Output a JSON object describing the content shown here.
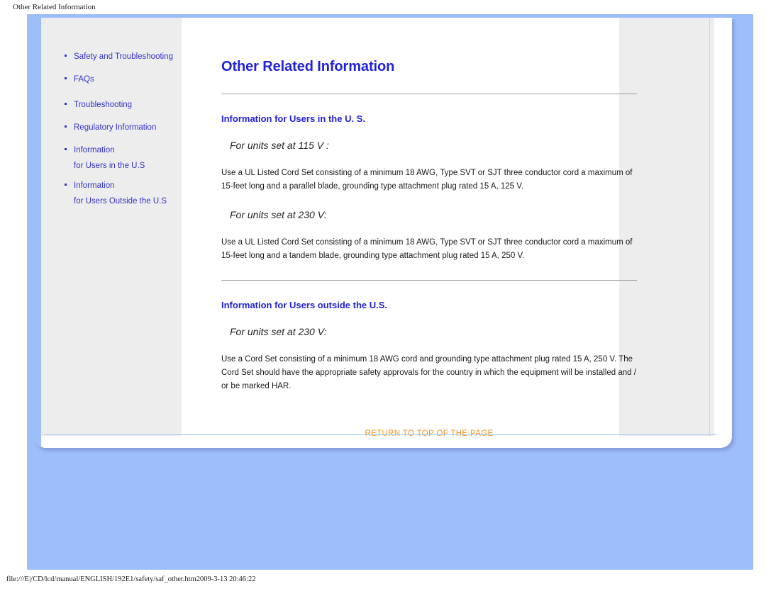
{
  "document": {
    "window_title": "Other Related Information",
    "footer_path": "file:///E|/CD/lcd/manual/ENGLISH/192E1/safety/saf_other.htm2009-3-13 20:46:22"
  },
  "colors": {
    "heading_blue": "#2222dd",
    "link_blue": "#3333cc",
    "accent_orange": "#f7941e",
    "page_background_blue": "#9dbdfb",
    "panel_grey": "#ededed"
  },
  "sidebar": {
    "items": [
      {
        "label": "Safety and Troubleshooting",
        "sub": ""
      },
      {
        "label": "FAQs",
        "sub": ""
      },
      {
        "label": "Troubleshooting",
        "sub": ""
      },
      {
        "label": "Regulatory Information",
        "sub": ""
      },
      {
        "label": "Information",
        "sub": "for Users in the U.S"
      },
      {
        "label": "Information",
        "sub": "for Users Outside the U.S"
      }
    ]
  },
  "main": {
    "page_title": "Other Related Information",
    "sections": [
      {
        "heading": "Information for Users in the U. S.",
        "blocks": [
          {
            "units": "For units set at 115 V :",
            "body": "Use a UL Listed Cord Set consisting of a minimum 18 AWG, Type SVT or SJT three conductor cord a maximum of 15-feet long and a parallel blade, grounding type attachment plug rated 15 A, 125 V."
          },
          {
            "units": "For units set at 230 V:",
            "body": "Use a UL Listed Cord Set consisting of a minimum 18 AWG, Type SVT or SJT three conductor cord a maximum of 15-feet long and a tandem blade, grounding type attachment plug rated 15 A, 250 V."
          }
        ]
      },
      {
        "heading": "Information for Users outside the U.S.",
        "blocks": [
          {
            "units": "For units set at 230 V:",
            "body": "Use a Cord Set consisting of a minimum 18 AWG cord and grounding type attachment plug rated 15 A, 250 V. The Cord Set should have the appropriate safety approvals for the country in which the equipment will be installed and / or be marked HAR."
          }
        ]
      }
    ],
    "return_to_top": "RETURN TO TOP OF THE PAGE"
  }
}
